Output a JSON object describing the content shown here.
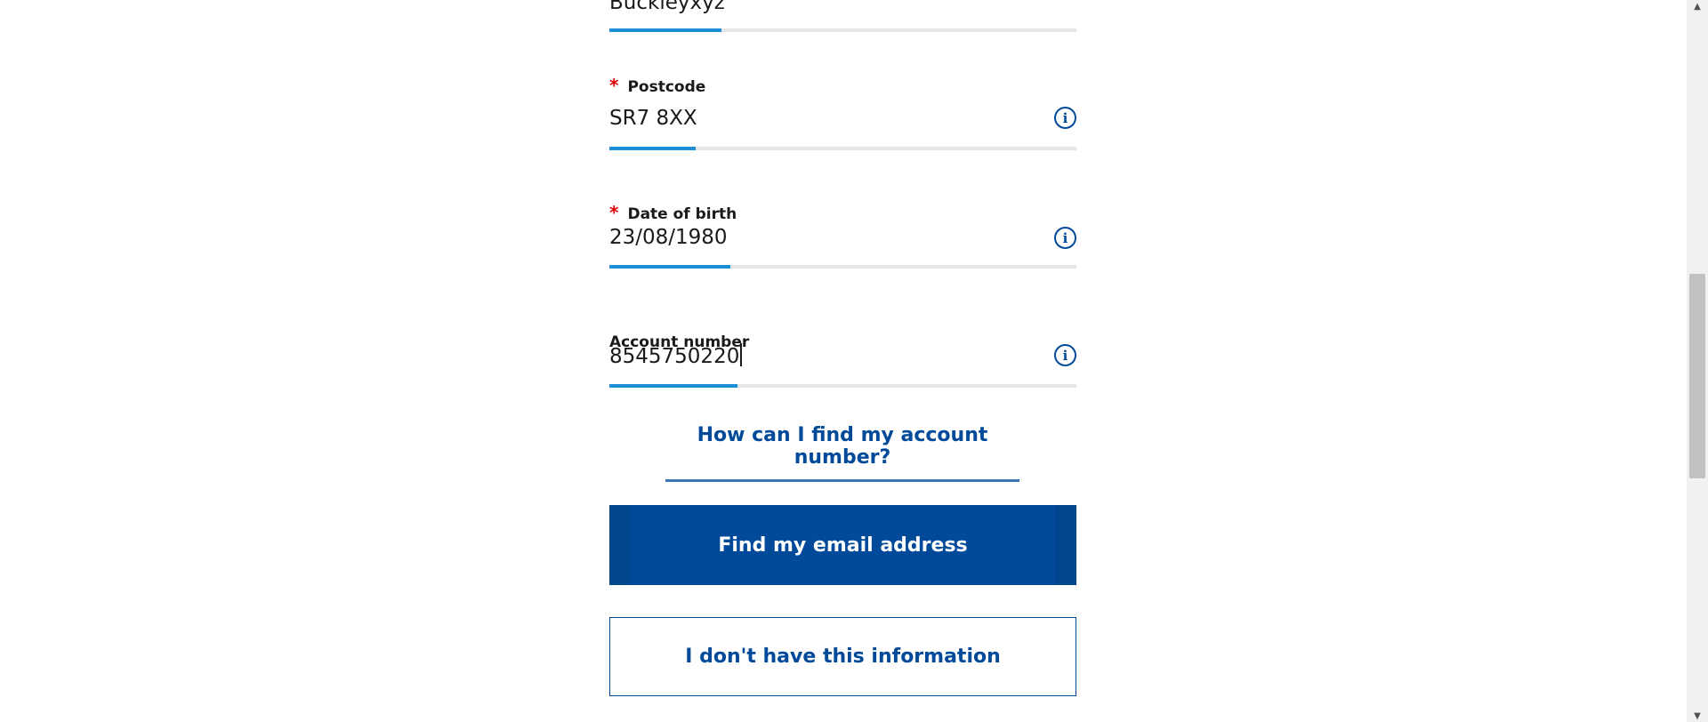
{
  "form": {
    "surname": {
      "value": "Buckleyxyz"
    },
    "postcode": {
      "required_mark": "*",
      "label": "Postcode",
      "value": "SR7 8XX",
      "info": "i"
    },
    "dob": {
      "required_mark": "*",
      "label": "Date of birth",
      "value": "23/08/1980",
      "info": "i"
    },
    "account": {
      "label": "Account number",
      "value": "8545750220",
      "info": "i"
    },
    "help_link": "How can I find my account number?",
    "primary_button": "Find my email address",
    "secondary_button": "I don't have this information"
  },
  "scrollbar": {
    "up_arrow": "▲",
    "down_arrow": "▼"
  },
  "colors": {
    "accent": "#1a8fd8",
    "brand": "#004a99",
    "required": "#e00000",
    "track": "#e6e6e6"
  }
}
